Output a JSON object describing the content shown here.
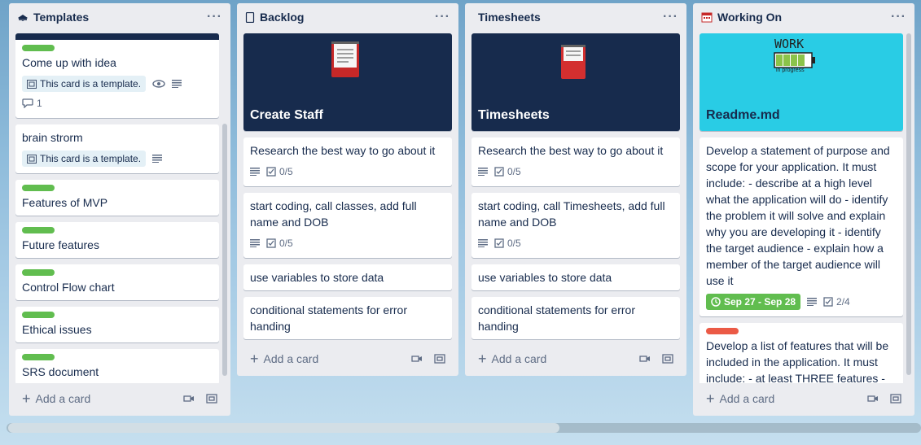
{
  "lists": [
    {
      "title": "Templates",
      "cards": [
        {
          "title": "Come up with idea",
          "template_badge": "This card is a template.",
          "comments": "1"
        },
        {
          "title": "brain strorm",
          "template_badge": "This card is a template."
        },
        {
          "title": "Features of MVP"
        },
        {
          "title": "Future features"
        },
        {
          "title": "Control Flow chart"
        },
        {
          "title": "Ethical issues"
        },
        {
          "title": "SRS document"
        }
      ],
      "add_label": "Add a card"
    },
    {
      "title": "Backlog",
      "cover_title": "Create Staff",
      "cards": [
        {
          "title": "Research the best way to go about it",
          "checklist": "0/5"
        },
        {
          "title": "start coding, call classes, add full name and DOB",
          "checklist": "0/5"
        },
        {
          "title": "use variables to store data"
        },
        {
          "title": "conditional statements for error handing"
        }
      ],
      "add_label": "Add a card"
    },
    {
      "title": "Timesheets",
      "cover_title": "Timesheets",
      "cards": [
        {
          "title": "Research the best way to go about it",
          "checklist": "0/5"
        },
        {
          "title": "start coding, call Timesheets, add full name and DOB",
          "checklist": "0/5"
        },
        {
          "title": "use variables to store data"
        },
        {
          "title": "conditional statements for error handing"
        }
      ],
      "add_label": "Add a card"
    },
    {
      "title": "Working On",
      "cover_title": "Readme.md",
      "cover_art_text": "WORK",
      "cover_art_sub": "in progress",
      "cards": [
        {
          "title": "Develop a statement of purpose and scope for your application. It must include: - describe at a high level what the application will do - identify the problem it will solve and explain why you are developing it - identify the target audience - explain how a member of the target audience will use it",
          "due": "Sep 27 - Sep 28",
          "checklist": "2/4"
        },
        {
          "title": "Develop a list of features that will be included in the application. It must include: - at least THREE features -"
        }
      ],
      "add_label": "Add a card"
    }
  ],
  "colors": {
    "label_green": "#61bd4f",
    "label_red": "#eb5a46",
    "cover_dark": "#172b4d",
    "cover_cyan": "#29cce5"
  }
}
